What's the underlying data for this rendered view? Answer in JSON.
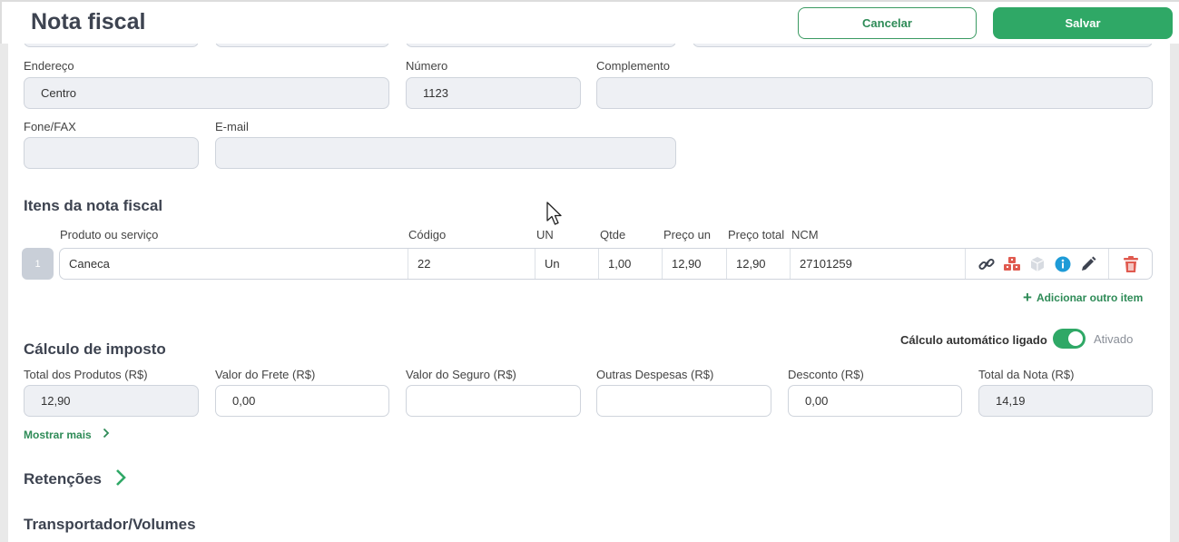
{
  "header": {
    "title": "Nota fiscal",
    "cancel_label": "Cancelar",
    "save_label": "Salvar"
  },
  "address": {
    "endereco_label": "Endereço",
    "endereco_value": "Centro",
    "numero_label": "Número",
    "numero_value": "1123",
    "complemento_label": "Complemento",
    "complemento_value": "",
    "fone_label": "Fone/FAX",
    "fone_value": "",
    "email_label": "E-mail",
    "email_value": ""
  },
  "items": {
    "section_title": "Itens da nota fiscal",
    "columns": {
      "produto": "Produto ou serviço",
      "codigo": "Código",
      "un": "UN",
      "qtde": "Qtde",
      "preco_un": "Preço un",
      "preco_total": "Preço total",
      "ncm": "NCM"
    },
    "rows": [
      {
        "index": "1",
        "produto": "Caneca",
        "codigo": "22",
        "un": "Un",
        "qtde": "1,00",
        "preco_un": "12,90",
        "preco_total": "12,90",
        "ncm": "27101259"
      }
    ],
    "row_icons": [
      "link-icon",
      "boxes-icon",
      "package-icon",
      "info-icon",
      "pencil-icon",
      "trash-icon"
    ],
    "add_label": "Adicionar outro item"
  },
  "tax": {
    "section_title": "Cálculo de imposto",
    "auto_label": "Cálculo automático ligado",
    "auto_state": "Ativado",
    "auto_on": true,
    "fields": {
      "total_produtos_label": "Total dos Produtos (R$)",
      "total_produtos_value": "12,90",
      "frete_label": "Valor do Frete (R$)",
      "frete_value": "0,00",
      "seguro_label": "Valor do Seguro (R$)",
      "seguro_value": "",
      "outras_label": "Outras Despesas (R$)",
      "outras_value": "",
      "desconto_label": "Desconto (R$)",
      "desconto_value": "0,00",
      "total_nota_label": "Total da Nota (R$)",
      "total_nota_value": "14,19"
    },
    "more_label": "Mostrar mais"
  },
  "sections": {
    "retencoes": "Retenções",
    "transportador": "Transportador/Volumes"
  },
  "colors": {
    "accent": "#2fa866",
    "accent_dark": "#2e8b57",
    "delete": "#e05a4f",
    "info": "#1e9bd7"
  }
}
